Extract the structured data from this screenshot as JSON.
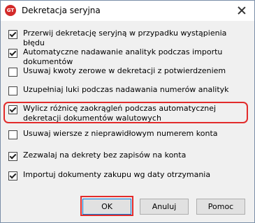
{
  "window": {
    "title": "Dekretacja seryjna",
    "app_icon_text": "GT"
  },
  "options": [
    {
      "label": "Przerwij dekretację seryjną w przypadku wystąpienia błędu",
      "checked": true
    },
    {
      "label": "Automatyczne nadawanie analityk podczas importu dokumentów",
      "checked": true
    },
    {
      "label": "Usuwaj kwoty zerowe w dekretacji z potwierdzeniem",
      "checked": false
    },
    {
      "label": "Uzupełniaj luki podczas nadawania numerów analityk",
      "checked": false
    },
    {
      "label": "Wylicz różnicę zaokrągleń podczas automatycznej dekretacji dokumentów walutowych",
      "checked": true
    },
    {
      "label": "Usuwaj wiersze z nieprawidłowym numerem konta",
      "checked": false
    },
    {
      "label": "Zezwalaj na dekrety bez zapisów na konta",
      "checked": true
    },
    {
      "label": "Importuj dokumenty zakupu wg daty otrzymania",
      "checked": true
    }
  ],
  "buttons": {
    "ok": "OK",
    "cancel": "Anuluj",
    "help": "Pomoc"
  },
  "colors": {
    "highlight": "#e22b2b",
    "default_button_border": "#0078d7"
  }
}
